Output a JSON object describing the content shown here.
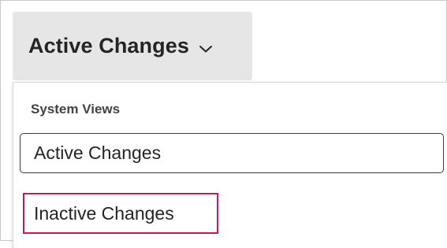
{
  "view_selector": {
    "label": "Active Changes",
    "chevron_icon": "chevron-down-icon"
  },
  "dropdown": {
    "section_header": "System Views",
    "items": [
      {
        "label": "Active Changes",
        "state": "selected"
      },
      {
        "label": "Inactive Changes",
        "state": "highlighted",
        "highlight_color": "#c2185b"
      }
    ]
  }
}
